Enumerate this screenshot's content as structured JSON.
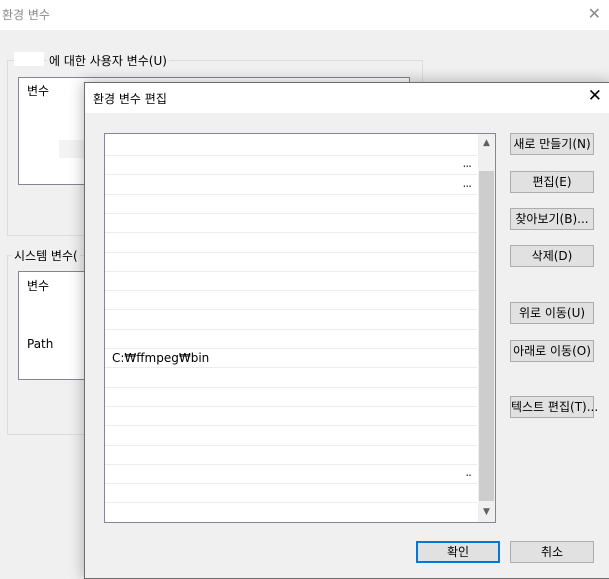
{
  "background_window": {
    "title": "환경 변수",
    "user_group_label": "에 대한 사용자 변수(U)",
    "user_list_header": "변수",
    "system_group_label": "시스템 변수(",
    "system_list_header": "변수",
    "system_row_path": "Path",
    "close_glyph": "✕"
  },
  "dialog": {
    "title": "환경 변수 편집",
    "close_glyph": "✕",
    "list": {
      "items": [
        {
          "text": "",
          "suffix": ""
        },
        {
          "text": "",
          "suffix": "..."
        },
        {
          "text": "",
          "suffix": "..."
        },
        {
          "text": "",
          "suffix": ""
        },
        {
          "text": "",
          "suffix": ""
        },
        {
          "text": "",
          "suffix": ""
        },
        {
          "text": "",
          "suffix": ""
        },
        {
          "text": "",
          "suffix": ""
        },
        {
          "text": "",
          "suffix": ""
        },
        {
          "text": "",
          "suffix": ""
        },
        {
          "text": "",
          "suffix": ""
        },
        {
          "text": "C:₩ffmpeg₩bin",
          "suffix": ""
        },
        {
          "text": "",
          "suffix": ""
        },
        {
          "text": "",
          "suffix": ""
        },
        {
          "text": "",
          "suffix": ""
        },
        {
          "text": "",
          "suffix": ""
        },
        {
          "text": "",
          "suffix": ""
        },
        {
          "text": "",
          "suffix": ".."
        },
        {
          "text": "",
          "suffix": ""
        },
        {
          "text": "",
          "suffix": ""
        }
      ]
    },
    "scroll_up_glyph": "▲",
    "scroll_down_glyph": "▼",
    "buttons": {
      "new": "새로 만들기(N)",
      "edit": "편집(E)",
      "browse": "찾아보기(B)...",
      "delete": "삭제(D)",
      "move_up": "위로 이동(U)",
      "move_down": "아래로 이동(O)",
      "edit_text": "텍스트 편집(T)...",
      "ok": "확인",
      "cancel": "취소"
    }
  }
}
